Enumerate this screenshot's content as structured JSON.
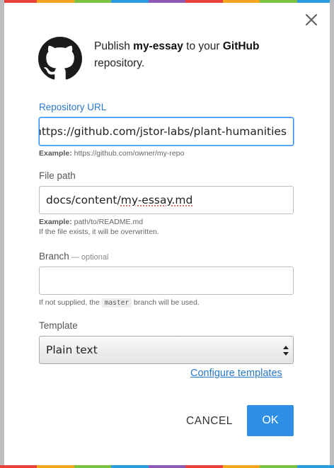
{
  "colors": {
    "accent": "#2a78c8",
    "ok_button": "#2f8fe6",
    "stripe": [
      "#e6413a",
      "#f3a51d",
      "#7cc142",
      "#2a9ce0",
      "#8e5ab5",
      "#e6413a",
      "#f3a51d",
      "#7cc142",
      "#2a9ce0"
    ]
  },
  "dialog": {
    "close_icon": "close-icon",
    "logo_icon": "github-octocat-icon",
    "publish_prefix": "Publish ",
    "publish_name": "my-essay",
    "publish_middle": " to your ",
    "publish_service": "GitHub",
    "publish_suffix": " repository."
  },
  "repo_url": {
    "label": "Repository URL",
    "value": "https://github.com/jstor-labs/plant-humanities",
    "help_prefix": "Example:",
    "help_example": " https://github.com/owner/my-repo"
  },
  "file_path": {
    "label": "File path",
    "value_prefix": "docs/content/",
    "value_flagged": "my-essay.md",
    "help_prefix": "Example:",
    "help_example": " path/to/README.md",
    "help_line2": "If the file exists, it will be overwritten."
  },
  "branch": {
    "label": "Branch",
    "label_optional": " — optional",
    "value": "",
    "help_before": "If not supplied, the ",
    "help_code": "master",
    "help_after": " branch will be used."
  },
  "template": {
    "label": "Template",
    "selected": "Plain text",
    "configure_link": "Configure templates"
  },
  "actions": {
    "cancel_label": "CANCEL",
    "ok_label": "OK"
  }
}
